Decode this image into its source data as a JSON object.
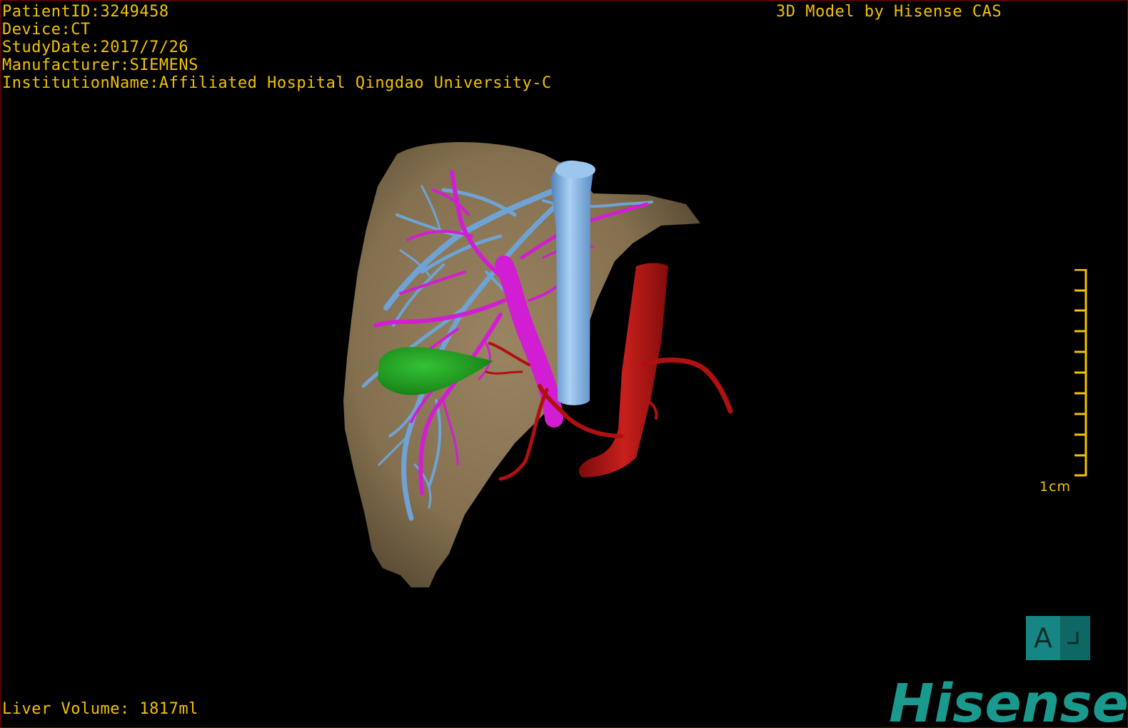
{
  "viewer": {
    "info": {
      "patient_id": "PatientID:3249458",
      "device": "Device:CT",
      "study_date": "StudyDate:2017/7/26",
      "manufacturer": "Manufacturer:SIEMENS",
      "institution": "InstitutionName:Affiliated Hospital Qingdao University-C"
    },
    "credit": "3D Model by Hisense CAS",
    "liver_volume": "Liver Volume: 1817ml",
    "scale_label": "1cm",
    "orientation_label": "A",
    "brand": "Hisense"
  },
  "colors": {
    "overlay_text": "#f2c200",
    "liver": "#8a7654",
    "portal_vein": "#d21ed2",
    "hepatic_vein": "#6fa3d6",
    "ivc": "#8cb8e8",
    "artery": "#b01010",
    "gallbladder": "#1f9a1f",
    "brand": "#1a9a8e",
    "orientation_cube": "#127a78"
  },
  "icons": {
    "orientation": "orientation-cube-icon",
    "scale": "scale-ruler-icon"
  }
}
